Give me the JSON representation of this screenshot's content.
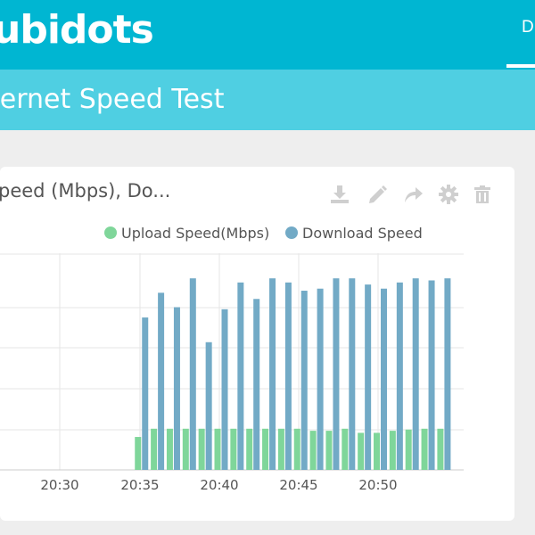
{
  "header": {
    "logo_text": "ubidots",
    "nav_tab_label": "D",
    "brand_color": "#00b6d2"
  },
  "dashboard": {
    "title": "ternet Speed Test",
    "subbar_color": "#4fcfe2"
  },
  "widget": {
    "title": "peed (Mbps), Do...",
    "toolbar_icons": [
      "download-icon",
      "pencil-icon",
      "share-icon",
      "gear-icon",
      "trash-icon"
    ]
  },
  "chart_data": {
    "type": "bar",
    "title": "",
    "xlabel": "",
    "ylabel": "",
    "grid": true,
    "legend_position": "top",
    "x_ticks": [
      "20:30",
      "20:35",
      "20:40",
      "20:45",
      "20:50"
    ],
    "categories": [
      "20:35",
      "20:36",
      "20:37",
      "20:38",
      "20:39",
      "20:40",
      "20:41",
      "20:42",
      "20:43",
      "20:44",
      "20:45",
      "20:46",
      "20:47",
      "20:48",
      "20:49",
      "20:50",
      "20:51",
      "20:52",
      "20:53",
      "20:54"
    ],
    "y_fraction_of_top_gridline_note": "",
    "ylim": [
      0,
      5
    ],
    "series": [
      {
        "name": "Upload Speed(Mbps)",
        "color": "#7fd69a",
        "values": [
          0.8,
          1.0,
          1.0,
          1.0,
          1.0,
          1.0,
          1.0,
          1.0,
          1.0,
          1.0,
          1.0,
          0.95,
          0.95,
          1.0,
          0.9,
          0.9,
          0.95,
          0.98,
          1.0,
          1.0
        ]
      },
      {
        "name": "Download Speed",
        "color": "#72aac6",
        "values": [
          3.7,
          4.3,
          3.95,
          4.65,
          3.1,
          3.9,
          4.55,
          4.15,
          4.65,
          4.55,
          4.35,
          4.4,
          4.65,
          4.65,
          4.5,
          4.4,
          4.55,
          4.65,
          4.6,
          4.65
        ]
      }
    ]
  }
}
